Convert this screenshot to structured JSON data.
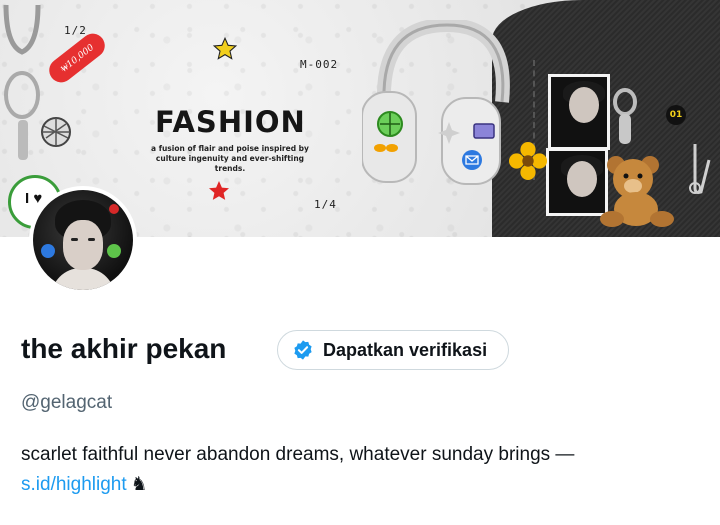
{
  "banner": {
    "label_page_top": "1/2",
    "label_code": "M-002",
    "label_page_bottom": "1/4",
    "title": "FASHION",
    "tagline_line1": "a fusion of flair and poise inspired by",
    "tagline_line2": "culture ingenuity and ever-shifting trends.",
    "price_tag": "₩10,000",
    "number_badge": "01",
    "sticker_text": "I ♥"
  },
  "profile": {
    "display_name": "the akhir pekan",
    "verify_button_label": "Dapatkan verifikasi",
    "handle": "@gelagcat",
    "bio_text": "scarlet faithful never abandon dreams, whatever sunday brings —",
    "bio_link": "s.id/highlight",
    "bio_emoji": "♞"
  },
  "colors": {
    "link": "#1d9bf0",
    "verified_badge": "#1d9bf0",
    "secondary_text": "#536471",
    "primary_text": "#0f1419"
  }
}
